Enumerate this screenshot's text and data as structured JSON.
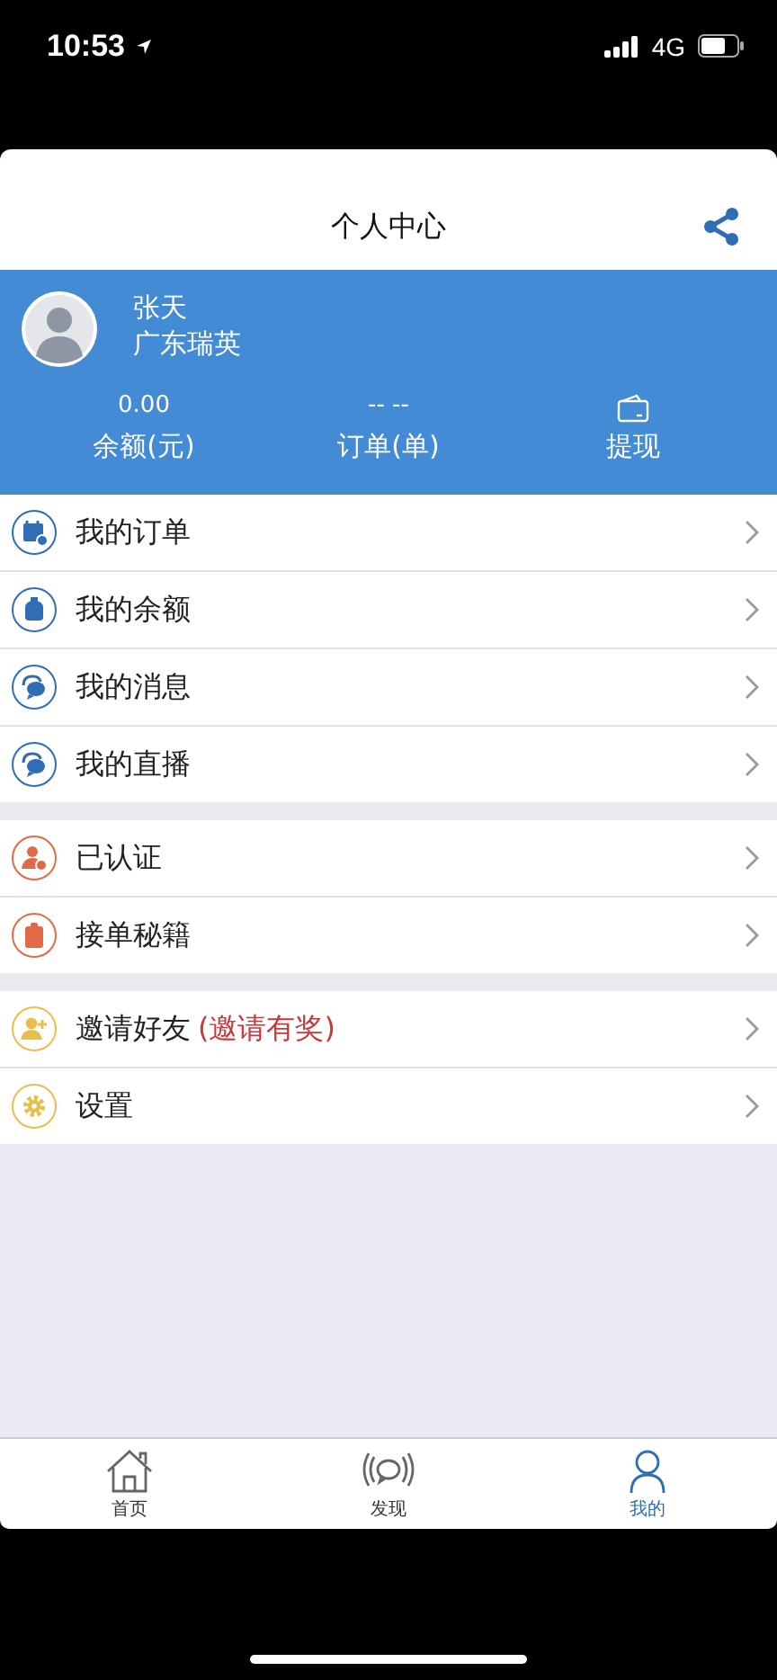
{
  "status_bar": {
    "time": "10:53",
    "network": "4G"
  },
  "header": {
    "title": "个人中心"
  },
  "profile": {
    "name": "张天",
    "company": "广东瑞英"
  },
  "stats": [
    {
      "kind": "value",
      "value": "0.00",
      "label": "余额(元)"
    },
    {
      "kind": "value",
      "value": "-- --",
      "label": "订单(单)"
    },
    {
      "kind": "wallet",
      "label": "提现"
    }
  ],
  "menu_groups": [
    {
      "items": [
        {
          "kind": "calendar",
          "color": "#2f6db5",
          "label": "我的订单"
        },
        {
          "kind": "bag",
          "color": "#2f6db5",
          "label": "我的余额"
        },
        {
          "kind": "chat",
          "color": "#2f6db5",
          "label": "我的消息"
        },
        {
          "kind": "chat",
          "color": "#2f6db5",
          "label": "我的直播"
        }
      ]
    },
    {
      "items": [
        {
          "kind": "person-check",
          "color": "#e06a45",
          "label": "已认证"
        },
        {
          "kind": "clipboard",
          "color": "#e06a45",
          "label": "接单秘籍"
        }
      ]
    },
    {
      "items": [
        {
          "kind": "person-plus",
          "color": "#e8bf4a",
          "label": "邀请好友",
          "note": "(邀请有奖)"
        },
        {
          "kind": "gear",
          "color": "#e8bf4a",
          "label": "设置"
        }
      ]
    }
  ],
  "tab_bar": [
    {
      "kind": "home",
      "label": "首页",
      "selected": false
    },
    {
      "kind": "discover",
      "label": "发现",
      "selected": false
    },
    {
      "kind": "person",
      "label": "我的",
      "selected": true
    }
  ]
}
